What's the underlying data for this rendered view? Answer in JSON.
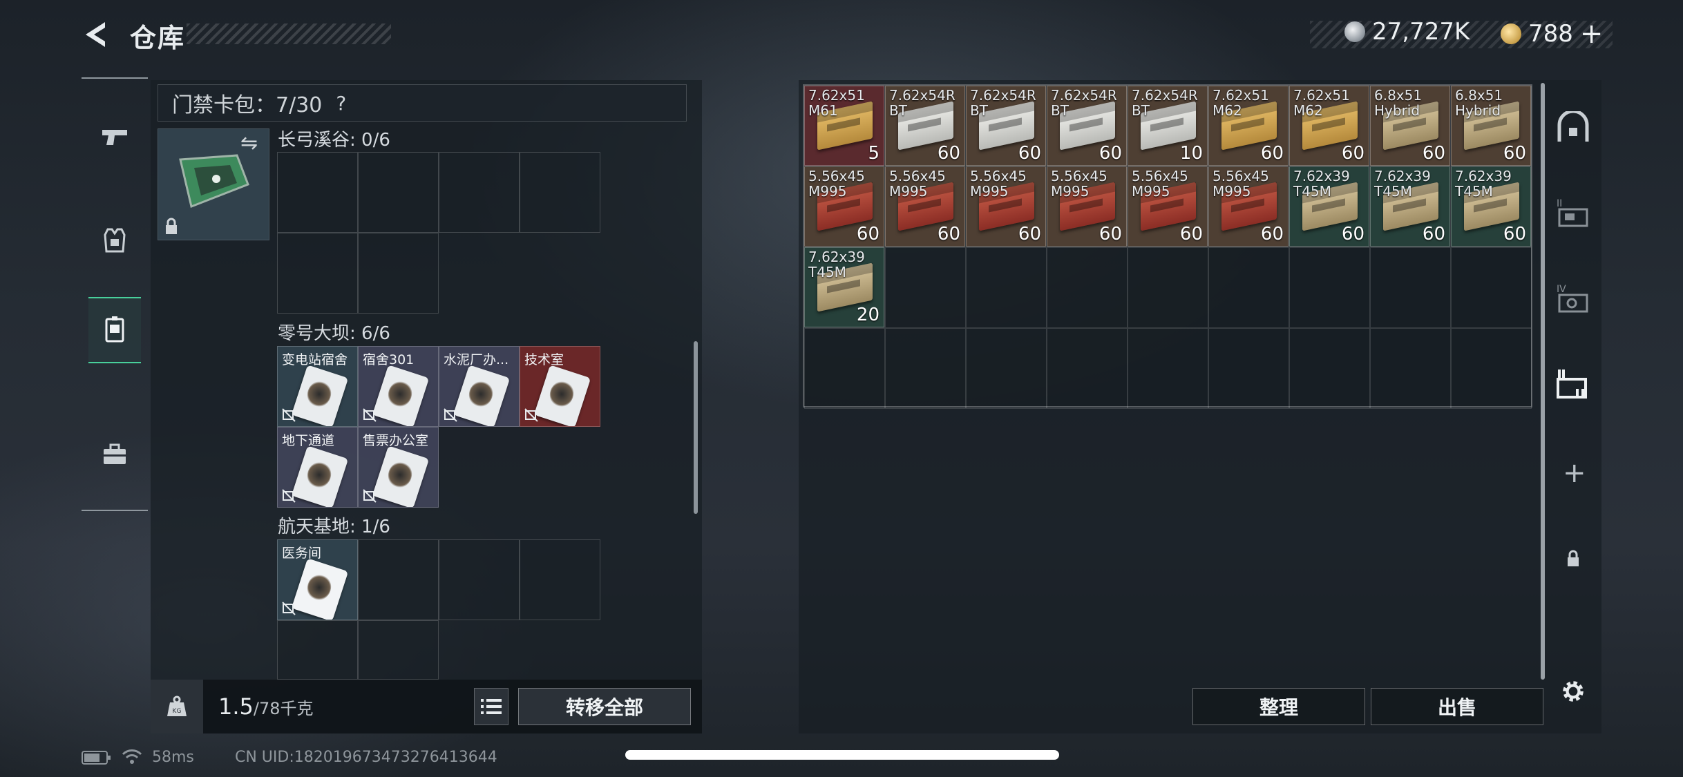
{
  "header": {
    "title": "仓库",
    "back_icon": "back-arrow-icon",
    "currency_silver": "27,727K",
    "currency_gold": "788",
    "currency_add": "+"
  },
  "left_nav": {
    "items": [
      "pistol-icon",
      "armor-vest-icon",
      "keycard-case-icon",
      "toolbox-icon"
    ],
    "active_index": 2
  },
  "key_bag": {
    "label": "门禁卡包：7/30",
    "help": "?",
    "sections": [
      {
        "title": "长弓溪谷: 0/6",
        "cards": []
      },
      {
        "title": "零号大坝: 6/6",
        "cards": [
          {
            "label": "变电站宿舍",
            "tint": "teal"
          },
          {
            "label": "宿舍301",
            "tint": "purple"
          },
          {
            "label": "水泥厂办...",
            "tint": "purple"
          },
          {
            "label": "技术室",
            "tint": "red"
          },
          {
            "label": "地下通道",
            "tint": "purple"
          },
          {
            "label": "售票办公室",
            "tint": "purple"
          }
        ]
      },
      {
        "title": "航天基地: 1/6",
        "cards": [
          {
            "label": "医务间",
            "tint": "teal"
          }
        ]
      }
    ]
  },
  "footer_left": {
    "weight_current": "1.5",
    "weight_max": "/78千克",
    "transfer_all": "转移全部"
  },
  "stash": {
    "items": [
      {
        "name": "7.62x51\nM61",
        "count": "5",
        "color": "red",
        "box": "gold"
      },
      {
        "name": "7.62x54R\nBT",
        "count": "60",
        "color": "brown",
        "box": "white"
      },
      {
        "name": "7.62x54R\nBT",
        "count": "60",
        "color": "brown",
        "box": "white"
      },
      {
        "name": "7.62x54R\nBT",
        "count": "60",
        "color": "brown",
        "box": "white"
      },
      {
        "name": "7.62x54R\nBT",
        "count": "10",
        "color": "brown",
        "box": "white"
      },
      {
        "name": "7.62x51\nM62",
        "count": "60",
        "color": "brown",
        "box": "gold"
      },
      {
        "name": "7.62x51\nM62",
        "count": "60",
        "color": "brown",
        "box": "gold"
      },
      {
        "name": "6.8x51\nHybrid",
        "count": "60",
        "color": "brown",
        "box": "tan"
      },
      {
        "name": "6.8x51\nHybrid",
        "count": "60",
        "color": "brown",
        "box": "tan"
      },
      {
        "name": "5.56x45\nM995",
        "count": "60",
        "color": "brown",
        "box": "redbox"
      },
      {
        "name": "5.56x45\nM995",
        "count": "60",
        "color": "brown",
        "box": "redbox"
      },
      {
        "name": "5.56x45\nM995",
        "count": "60",
        "color": "brown",
        "box": "redbox"
      },
      {
        "name": "5.56x45\nM995",
        "count": "60",
        "color": "brown",
        "box": "redbox"
      },
      {
        "name": "5.56x45\nM995",
        "count": "60",
        "color": "brown",
        "box": "redbox"
      },
      {
        "name": "5.56x45\nM995",
        "count": "60",
        "color": "brown",
        "box": "redbox"
      },
      {
        "name": "7.62x39\nT45M",
        "count": "60",
        "color": "green",
        "box": "tan"
      },
      {
        "name": "7.62x39\nT45M",
        "count": "60",
        "color": "green",
        "box": "tan"
      },
      {
        "name": "7.62x39\nT45M",
        "count": "60",
        "color": "green",
        "box": "tan"
      },
      {
        "name": "7.62x39\nT45M",
        "count": "20",
        "color": "green",
        "box": "tan"
      }
    ],
    "sort": "整理",
    "sell": "出售"
  },
  "right_sidebar": {
    "items": [
      "safe-icon",
      "stash-page-2-icon",
      "stash-page-4-icon",
      "stash-page-active-icon"
    ],
    "add": "+"
  },
  "status_bar": {
    "ping": "58ms",
    "uid": "CN UID:1820196734732764136​44"
  }
}
